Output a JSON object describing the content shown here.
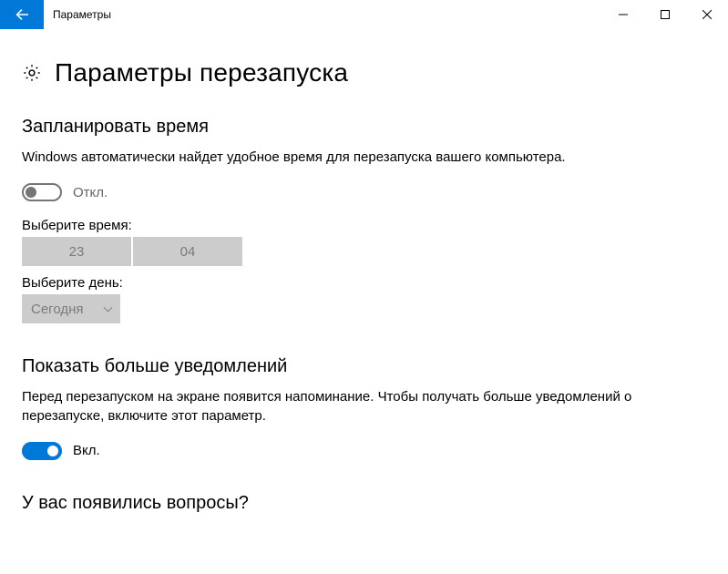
{
  "window": {
    "title": "Параметры"
  },
  "page": {
    "title": "Параметры перезапуска"
  },
  "schedule": {
    "heading": "Запланировать время",
    "desc": "Windows автоматически найдет удобное время для перезапуска вашего компьютера.",
    "toggle_label": "Откл.",
    "time_label": "Выберите время:",
    "time_hour": "23",
    "time_min": "04",
    "day_label": "Выберите день:",
    "day_value": "Сегодня"
  },
  "notify": {
    "heading": "Показать больше уведомлений",
    "desc": "Перед перезапуском на экране появится напоминание. Чтобы получать больше уведомлений о перезапуске, включите этот параметр.",
    "toggle_label": "Вкл."
  },
  "help": {
    "heading": "У вас появились вопросы?"
  }
}
